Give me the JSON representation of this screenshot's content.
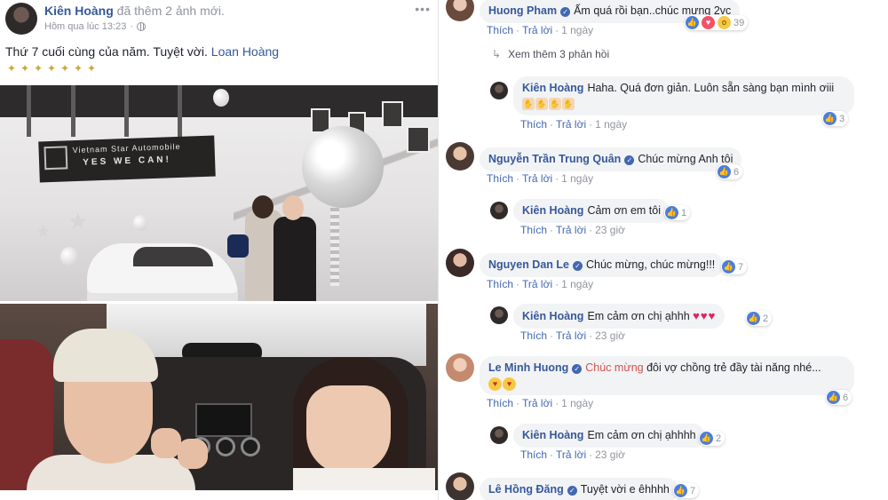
{
  "post": {
    "author": "Kiên Hoàng",
    "action": "đã thêm 2 ảnh mới.",
    "time": "Hôm qua lúc 13:23",
    "separator": "·",
    "text": "Thứ 7 cuối cùng của năm. Tuyệt vời.",
    "mention": "Loan Hoàng",
    "photo_sign_line1": "Vietnam Star Automobile",
    "photo_sign_line2": "YES WE CAN!"
  },
  "colors": {
    "link": "#365899",
    "action_link": "#4267b2",
    "bubble_bg": "#f2f3f5",
    "meta": "#90949c",
    "like": "#4a7dde",
    "heart": "#f25268"
  },
  "comments": [
    {
      "name": "Huong Pham",
      "text": "Ấm quá rồi bạn..chúc mưng 2vc",
      "actions": [
        "Thích",
        "Trả lời"
      ],
      "time": "1 ngày",
      "reactions": [
        "like-icon",
        "heart-icon",
        "wow-icon"
      ],
      "count": "39"
    },
    {
      "more_replies": "Xem thêm 3 phản hồi"
    },
    {
      "name": "Kiên Hoàng",
      "text": "Haha. Quá đơn giản. Luôn sẵn sàng bạn mình ơiii",
      "actions": [
        "Thích",
        "Trả lời"
      ],
      "time": "1 ngày",
      "count": "3"
    },
    {
      "name": "Nguyễn Trần Trung Quân",
      "text": "Chúc mừng Anh tôi",
      "actions": [
        "Thích",
        "Trả lời"
      ],
      "time": "1 ngày",
      "count": "6"
    },
    {
      "name": "Kiên Hoàng",
      "text": "Cảm ơn em tôi",
      "actions": [
        "Thích",
        "Trả lời"
      ],
      "time": "23 giờ",
      "count": "1"
    },
    {
      "name": "Nguyen Dan Le",
      "text": "Chúc mừng, chúc mừng!!!",
      "actions": [
        "Thích",
        "Trả lời"
      ],
      "time": "1 ngày",
      "count": "7"
    },
    {
      "name": "Kiên Hoàng",
      "text": "Em cảm ơn chị ạhhh",
      "actions": [
        "Thích",
        "Trả lời"
      ],
      "time": "23 giờ",
      "count": "2"
    },
    {
      "name": "Le Minh Huong",
      "highlight": "Chúc mừng",
      "text": "đôi vợ chồng trẻ đầy tài năng nhé...",
      "actions": [
        "Thích",
        "Trả lời"
      ],
      "time": "1 ngày",
      "count": "6"
    },
    {
      "name": "Kiên Hoàng",
      "text": "Em cảm ơn chị ạhhhh",
      "actions": [
        "Thích",
        "Trả lời"
      ],
      "time": "23 giờ",
      "count": "2"
    },
    {
      "name": "Lê Hồng Đăng",
      "text": "Tuyệt vời e êhhhh",
      "count": "7"
    }
  ]
}
